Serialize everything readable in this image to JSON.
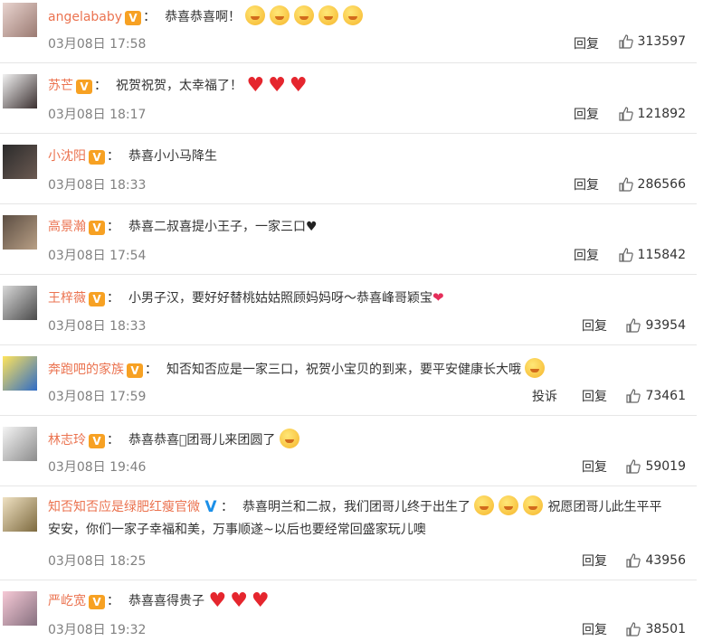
{
  "ui": {
    "reply_label": "回复",
    "report_label": "投诉",
    "verified_mark": "V",
    "name_colon": "："
  },
  "comments": [
    {
      "name": "angelababy",
      "text": "恭喜恭喜啊！",
      "trailing": "",
      "icons": [
        "emoji-smile",
        "emoji-smile",
        "emoji-smile",
        "emoji-smile",
        "emoji-smile"
      ],
      "time": "03月08日 17:58",
      "likes": "313597",
      "badge": "gold",
      "report": false
    },
    {
      "name": "苏芒",
      "text": "祝贺祝贺，太幸福了！",
      "trailing": "",
      "icons": [
        "heart",
        "heart",
        "heart"
      ],
      "time": "03月08日 18:17",
      "likes": "121892",
      "badge": "gold",
      "report": false
    },
    {
      "name": "小沈阳",
      "text": "恭喜小小马降生",
      "trailing": "",
      "icons": [],
      "time": "03月08日 18:33",
      "likes": "286566",
      "badge": "gold",
      "report": false
    },
    {
      "name": "高景瀚",
      "text": "恭喜二叔喜提小王子，一家三口",
      "trailing": "♥",
      "icons": [],
      "time": "03月08日 17:54",
      "likes": "115842",
      "badge": "gold",
      "report": false
    },
    {
      "name": "王梓薇",
      "text": "小男子汉，要好好替桃姑姑照顾妈妈呀～恭喜峰哥颖宝",
      "trailing": "❤",
      "icons": [],
      "time": "03月08日 18:33",
      "likes": "93954",
      "badge": "gold",
      "report": false
    },
    {
      "name": "奔跑吧的家族",
      "text": "知否知否应是一家三口，祝贺小宝贝的到来，要平安健康长大哦",
      "trailing": "",
      "icons": [
        "emoji-kiss"
      ],
      "time": "03月08日 17:59",
      "likes": "73461",
      "badge": "gold",
      "report": true
    },
    {
      "name": "林志玲",
      "text": "恭喜恭喜􏰀团哥儿来团圆了",
      "trailing": "",
      "icons": [
        "emoji-clap"
      ],
      "time": "03月08日 19:46",
      "likes": "59019",
      "badge": "gold",
      "report": false
    },
    {
      "name": "知否知否应是绿肥红瘦官微",
      "text": "恭喜明兰和二叔，我们团哥儿终于出生了",
      "text2": "祝愿团哥儿此生平平安安，你们一家子幸福和美，万事顺遂~以后也要经常回盛家玩儿噢",
      "trailing": "",
      "icons": [
        "emoji-smile",
        "emoji-kiss",
        "emoji-smile"
      ],
      "time": "03月08日 18:25",
      "likes": "43956",
      "badge": "blue",
      "report": false
    },
    {
      "name": "严屹宽",
      "text": "恭喜喜得贵子",
      "trailing": "",
      "icons": [
        "heart",
        "heart",
        "heart"
      ],
      "time": "03月08日 19:32",
      "likes": "38501",
      "badge": "gold",
      "report": false
    }
  ],
  "colors": {
    "name": "#eb7350",
    "badge_gold": "#f7a123",
    "badge_blue": "#1b8fe8",
    "heart": "#e5262e",
    "time": "#808080"
  }
}
